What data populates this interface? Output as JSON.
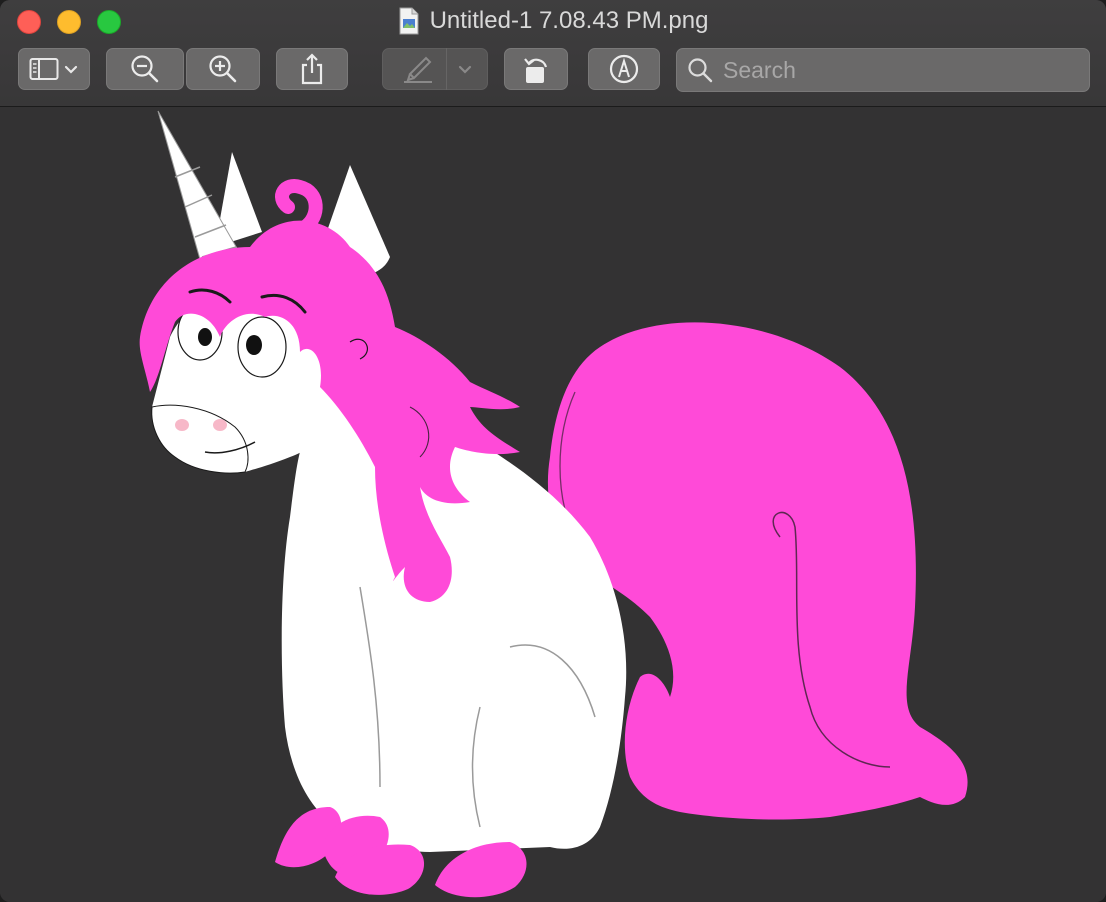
{
  "window": {
    "title": "Untitled-1 7.08.43 PM.png",
    "title_icon": "document-preview-icon"
  },
  "toolbar": {
    "search_placeholder": "Search",
    "search_value": "",
    "icons": [
      "sidebar-icon",
      "chevron-down-icon",
      "zoom-out-icon",
      "zoom-in-icon",
      "share-icon",
      "highlight-pen-icon",
      "rotate-left-icon",
      "markup-icon",
      "search-icon"
    ]
  },
  "image": {
    "subject": "unicorn",
    "colors": {
      "background": "#333233",
      "body": "#ffffff",
      "mane": "#ff4ad8",
      "outline": "#1a1a1a",
      "nostril": "#f7b8c8"
    }
  },
  "colors": {
    "close": "#fe5f57",
    "minimize": "#febc2e",
    "maximize": "#28c840",
    "toolbar_button": "#6a6969"
  }
}
